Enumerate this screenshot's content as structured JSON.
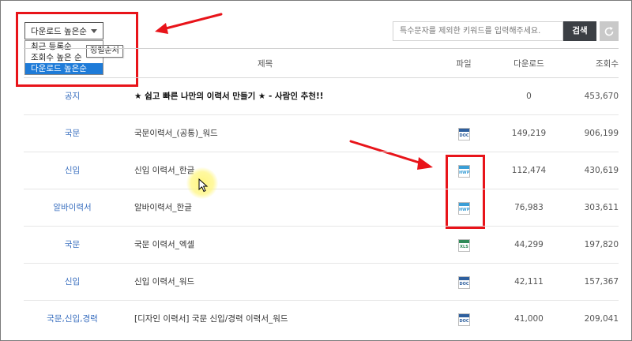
{
  "sort": {
    "selected_label": "다운로드 높은순",
    "options": [
      "최근 등록순",
      "조회수 높은 순",
      "다운로드 높은순"
    ],
    "tooltip": "정렬순서"
  },
  "search": {
    "placeholder": "특수문자를 제외한 키워드를 입력해주세요.",
    "button_label": "검색"
  },
  "table": {
    "headers": {
      "title": "제목",
      "file": "파일",
      "downloads": "다운로드",
      "views": "조회수"
    },
    "rows": [
      {
        "category": "공지",
        "title": "★ 쉽고 빠른 나만의 이력서 만들기 ★ - 사람인 추천!!",
        "file": "",
        "downloads": "0",
        "views": "453,670"
      },
      {
        "category": "국문",
        "title": "국문이력서_(공통)_워드",
        "file": "DOC",
        "downloads": "149,219",
        "views": "906,199"
      },
      {
        "category": "신입",
        "title": "신입 이력서_한글",
        "file": "HWP",
        "downloads": "112,474",
        "views": "430,619"
      },
      {
        "category": "알바이력서",
        "title": "알바이력서_한글",
        "file": "HWP",
        "downloads": "76,983",
        "views": "303,611"
      },
      {
        "category": "국문",
        "title": "국문 이력서_엑셀",
        "file": "XLS",
        "downloads": "44,299",
        "views": "197,820"
      },
      {
        "category": "신입",
        "title": "신입 이력서_워드",
        "file": "DOC",
        "downloads": "42,111",
        "views": "157,367"
      },
      {
        "category": "국문,신입,경력",
        "title": "[디자인 이력서] 국문 신입/경력 이력서_워드",
        "file": "DOC",
        "downloads": "41,000",
        "views": "209,041"
      }
    ]
  },
  "colors": {
    "annotation_red": "#e8141a",
    "category_blue": "#3a6fbf",
    "selected_option_bg": "#1e7bd8",
    "search_button_bg": "#3b3f44"
  },
  "icons": [
    "chevron-down-icon",
    "refresh-icon",
    "doc-file-icon",
    "hwp-file-icon",
    "xls-file-icon",
    "mouse-cursor-icon"
  ]
}
